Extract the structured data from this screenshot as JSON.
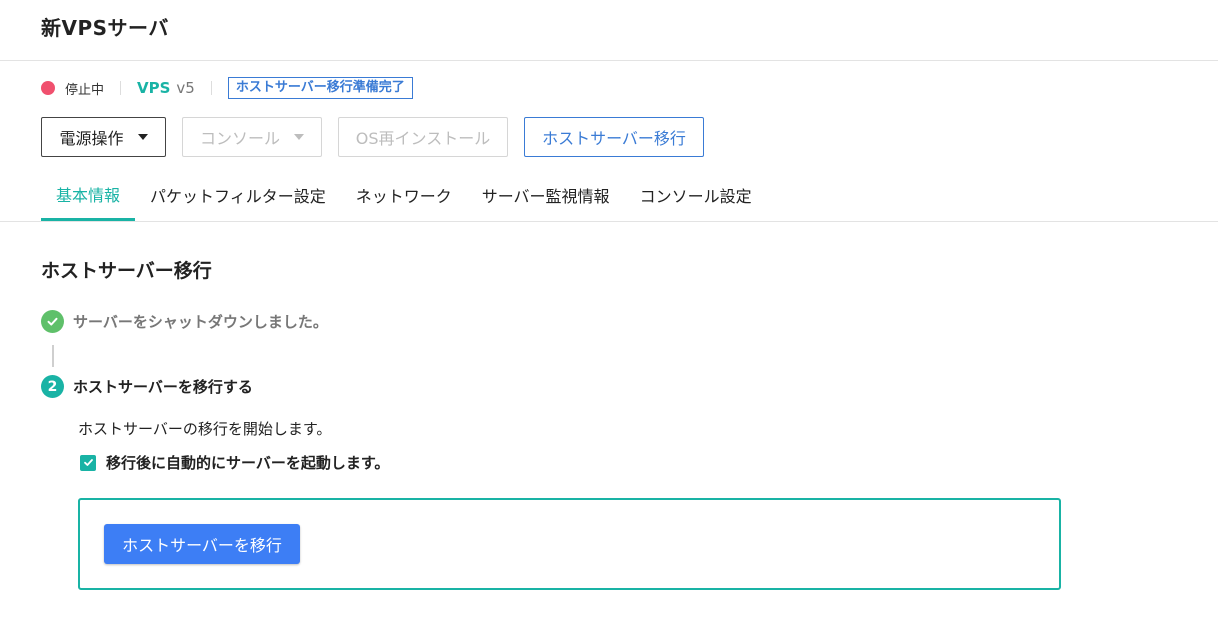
{
  "header": {
    "title": "新VPSサーバ"
  },
  "status": {
    "state_text": "停止中",
    "state_color": "#f0506e",
    "plan_name": "VPS",
    "plan_version": "v5",
    "badge": "ホストサーバー移行準備完了"
  },
  "toolbar": {
    "power_label": "電源操作",
    "console_label": "コンソール",
    "reinstall_label": "OS再インストール",
    "migrate_label": "ホストサーバー移行"
  },
  "tabs": [
    {
      "label": "基本情報",
      "active": true
    },
    {
      "label": "パケットフィルター設定",
      "active": false
    },
    {
      "label": "ネットワーク",
      "active": false
    },
    {
      "label": "サーバー監視情報",
      "active": false
    },
    {
      "label": "コンソール設定",
      "active": false
    }
  ],
  "section": {
    "title": "ホストサーバー移行",
    "step1": {
      "text": "サーバーをシャットダウンしました。",
      "icon": "check-circle-icon",
      "done": true
    },
    "step2": {
      "number": "2",
      "text": "ホストサーバーを移行する",
      "description": "ホストサーバーの移行を開始します。",
      "auto_start_label": "移行後に自動的にサーバーを起動します。",
      "auto_start_checked": true
    },
    "action_button": "ホストサーバーを移行"
  },
  "colors": {
    "accent": "#19b3a5",
    "primary": "#3d7ef5",
    "link": "#3a7bd5",
    "success": "#5fc06a"
  }
}
